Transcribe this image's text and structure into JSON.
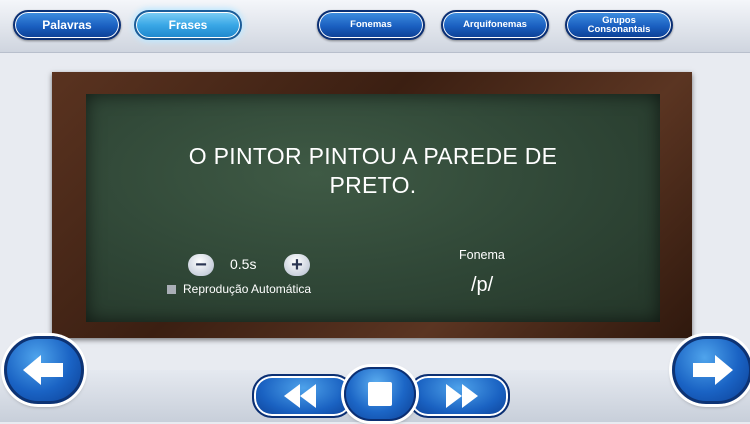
{
  "tabs": {
    "palavras": "Palavras",
    "frases": "Frases",
    "fonemas": "Fonemas",
    "arquifonemas": "Arquifonemas",
    "grupos_line1": "Grupos",
    "grupos_line2": "Consonantais"
  },
  "board": {
    "sentence_line1": "O PINTOR PINTOU A PAREDE DE",
    "sentence_line2": "PRETO.",
    "speed_value": "0.5s",
    "minus_symbol": "−",
    "plus_symbol": "+",
    "autoplay_label": "Reprodução Automática",
    "phoneme_label": "Fonema",
    "phoneme_value": "/p/"
  },
  "icons": {
    "prev": "arrow-left-icon",
    "next": "arrow-right-icon",
    "rewind": "rewind-icon",
    "stop": "stop-icon",
    "forward": "fast-forward-icon"
  },
  "colors": {
    "accent": "#1a5fc0",
    "active_tab": "#3aa7e6",
    "board": "#2f4636",
    "frame": "#4a2a19"
  }
}
